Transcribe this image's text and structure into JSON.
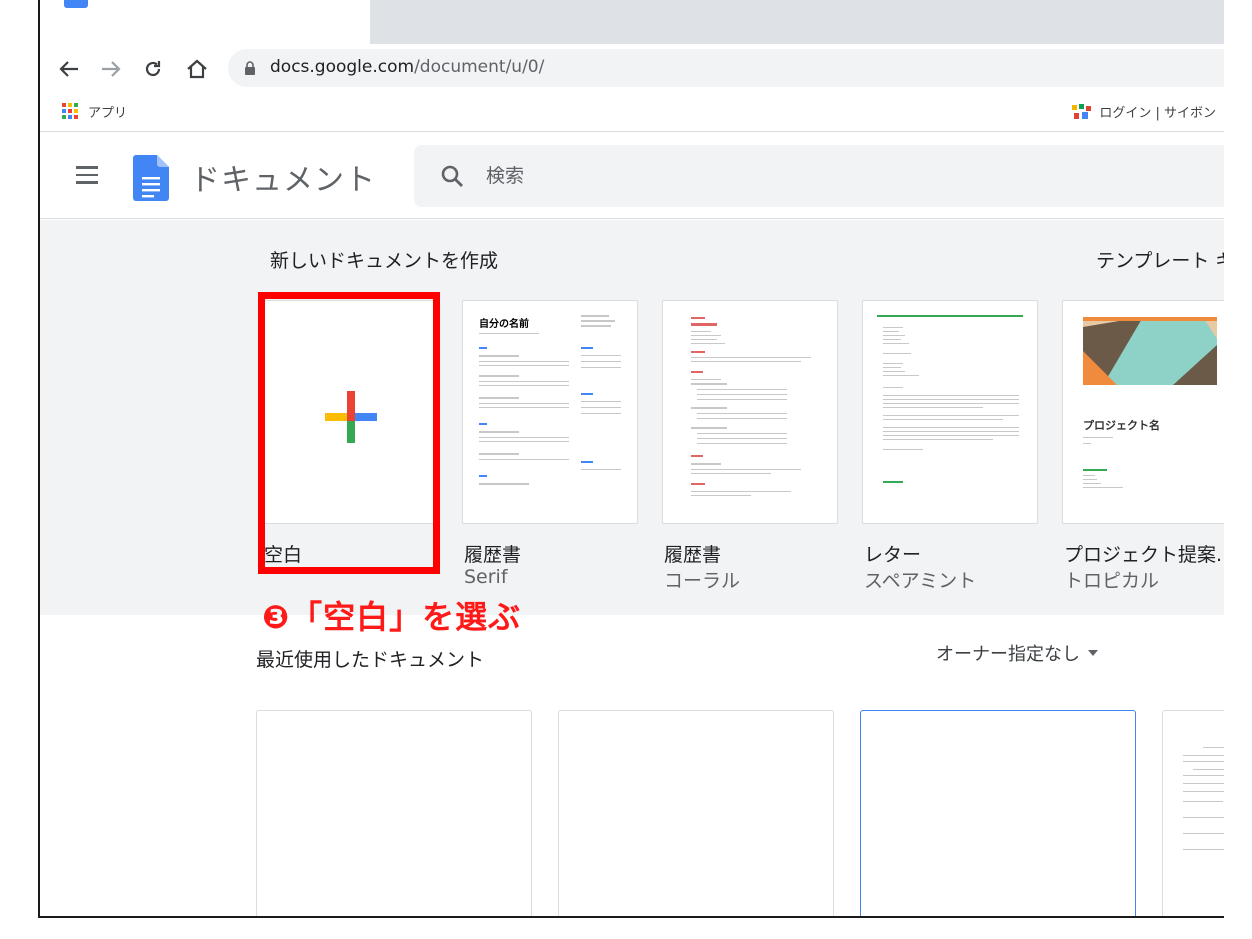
{
  "browser": {
    "url_host": "docs.google.com",
    "url_path": "/document/u/0/",
    "bookmarks": {
      "apps_label": "アプリ",
      "right_label": "ログイン | サイボン"
    }
  },
  "header": {
    "app_title": "ドキュメント",
    "search_placeholder": "検索"
  },
  "gallery": {
    "title": "新しいドキュメントを作成",
    "right_label": "テンプレート ギ",
    "templates": [
      {
        "name": "空白",
        "sub": ""
      },
      {
        "name": "履歴書",
        "sub": "Serif",
        "preview_heading": "自分の名前"
      },
      {
        "name": "履歴書",
        "sub": "コーラル"
      },
      {
        "name": "レター",
        "sub": "スペアミント"
      },
      {
        "name": "プロジェクト提案...",
        "sub": "トロピカル",
        "preview_heading": "プロジェクト名"
      }
    ]
  },
  "annotation": {
    "marker": "❸",
    "text": "「空白」を選ぶ"
  },
  "recent": {
    "title": "最近使用したドキュメント",
    "owner_filter": "オーナー指定なし"
  },
  "colors": {
    "highlight": "#ff0000",
    "annotation": "#ff1a1a",
    "gallery_bg": "#f1f3f4",
    "docs_blue": "#4285f4"
  }
}
